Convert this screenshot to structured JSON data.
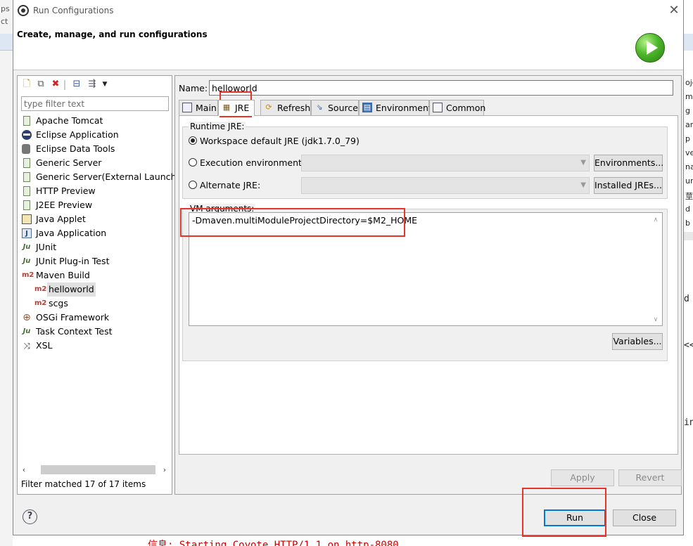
{
  "background": {
    "left_text_1": "ps",
    "left_text_2": "ct",
    "right_items": [
      "oje",
      "m",
      "g",
      "ar",
      "p",
      "ve",
      "na",
      "ur",
      "莖",
      "d",
      "b"
    ],
    "right_mono_1": "d",
    "right_mono_2": "<<",
    "right_mono_3": "in",
    "bottom_console": "信息: Starting Coyote HTTP/1.1 on http-8080"
  },
  "dialog": {
    "title": "Run Configurations",
    "header_title": "Create, manage, and run configurations"
  },
  "left": {
    "filter_placeholder": "type filter text",
    "tree": [
      {
        "label": "Apache Tomcat",
        "icon": "tomcat-icon",
        "indent": 0
      },
      {
        "label": "Eclipse Application",
        "icon": "eclipse-icon",
        "indent": 0
      },
      {
        "label": "Eclipse Data Tools",
        "icon": "database-icon",
        "indent": 0
      },
      {
        "label": "Generic Server",
        "icon": "server-icon",
        "indent": 0
      },
      {
        "label": "Generic Server(External Launch)",
        "icon": "server-icon",
        "indent": 0
      },
      {
        "label": "HTTP Preview",
        "icon": "server-icon",
        "indent": 0
      },
      {
        "label": "J2EE Preview",
        "icon": "server-icon",
        "indent": 0
      },
      {
        "label": "Java Applet",
        "icon": "applet-icon",
        "indent": 0
      },
      {
        "label": "Java Application",
        "icon": "java-app-icon",
        "indent": 0
      },
      {
        "label": "JUnit",
        "icon": "junit-icon",
        "indent": 0
      },
      {
        "label": "JUnit Plug-in Test",
        "icon": "junit-plugin-icon",
        "indent": 0
      },
      {
        "label": "Maven Build",
        "icon": "maven-icon",
        "indent": 0
      },
      {
        "label": "helloworld",
        "icon": "maven-icon",
        "indent": 1,
        "selected": true
      },
      {
        "label": "scgs",
        "icon": "maven-icon",
        "indent": 1
      },
      {
        "label": "OSGi Framework",
        "icon": "osgi-icon",
        "indent": 0
      },
      {
        "label": "Task Context Test",
        "icon": "junit-icon",
        "indent": 0
      },
      {
        "label": "XSL",
        "icon": "xsl-icon",
        "indent": 0
      }
    ],
    "filter_status": "Filter matched 17 of 17 items"
  },
  "right": {
    "name_label": "Name:",
    "name_value": "helloworld",
    "tabs": [
      {
        "label": "Main",
        "icon": "main-tab-icon"
      },
      {
        "label": "JRE",
        "icon": "jre-tab-icon",
        "active": true
      },
      {
        "label": "Refresh",
        "icon": "refresh-tab-icon"
      },
      {
        "label": "Source",
        "icon": "source-tab-icon"
      },
      {
        "label": "Environment",
        "icon": "environment-tab-icon"
      },
      {
        "label": "Common",
        "icon": "common-tab-icon"
      }
    ],
    "runtime_jre_label": "Runtime JRE:",
    "workspace_default_jre": "Workspace default JRE (jdk1.7.0_79)",
    "execution_environment": "Execution environment:",
    "alternate_jre": "Alternate JRE:",
    "environments_button": "Environments...",
    "installed_jres_button": "Installed JREs...",
    "vm_arguments_label": "VM arguments:",
    "vm_arguments_value": "-Dmaven.multiModuleProjectDirectory=$M2_HOME",
    "variables_button": "Variables...",
    "apply_button": "Apply",
    "revert_button": "Revert"
  },
  "footer": {
    "help_label": "?",
    "run_button": "Run",
    "close_button": "Close"
  },
  "colors": {
    "highlight_red": "#e8322a",
    "default_button_border": "#0078d7",
    "maven_icon": "#c0392b"
  }
}
